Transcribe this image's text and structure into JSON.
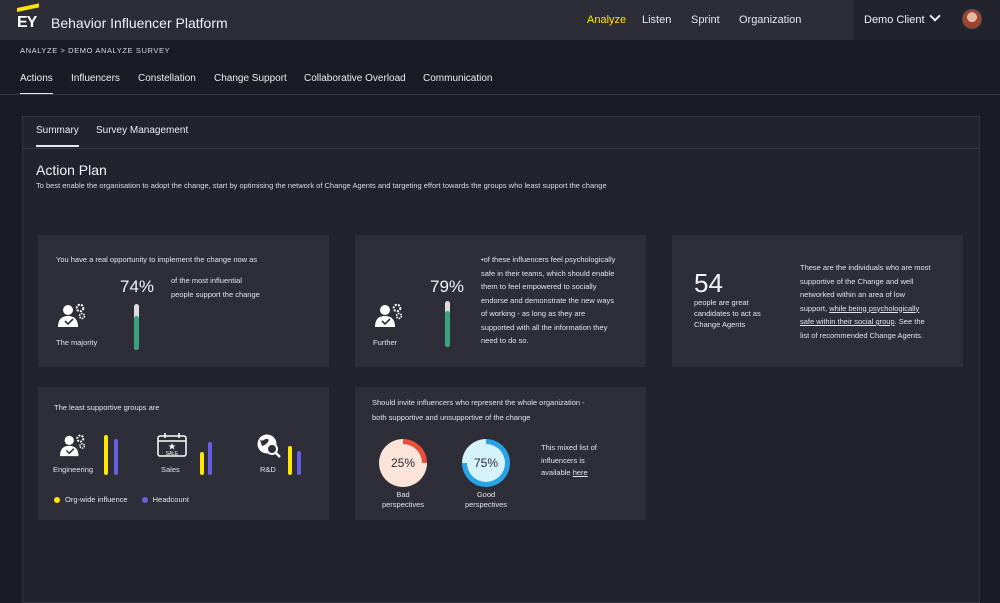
{
  "header": {
    "logo_text": "EY",
    "app_title": "Behavior Influencer Platform",
    "nav": [
      {
        "label": "Analyze",
        "active": true
      },
      {
        "label": "Listen",
        "active": false
      },
      {
        "label": "Sprint",
        "active": false
      },
      {
        "label": "Organization",
        "active": false
      }
    ],
    "client": "Demo Client",
    "icons": {
      "dropdown": "chevron-down-icon",
      "user": "avatar"
    }
  },
  "breadcrumb": "ANALYZE > DEMO ANALYZE SURVEY",
  "tabs": [
    "Actions",
    "Influencers",
    "Constellation",
    "Change Support",
    "Collaborative Overload",
    "Communication"
  ],
  "active_tab": "Actions",
  "subtabs": [
    "Summary",
    "Survey Management"
  ],
  "active_subtab": "Summary",
  "action_plan": {
    "title": "Action Plan",
    "subtitle": "To best enable the organisation to adopt the change, start by optimising the network of Change Agents and targeting effort towards the groups who least support the change"
  },
  "card1": {
    "heading": "You have a real opportunity to implement the change now as",
    "percent": "74%",
    "percent_value": 0.74,
    "text1": "of the most influential",
    "text2": "people support the change",
    "label": "The majority"
  },
  "card2": {
    "percent": "79%",
    "percent_value": 0.79,
    "label": "Further",
    "lines": [
      "•of these influencers feel psychologically",
      "safe in their teams, which should enable",
      "them to feel empowered to socially",
      "endorse and demonstrate the new ways",
      "of working - as long as they are",
      "supported with all the information they",
      "need to do so."
    ]
  },
  "card3": {
    "number": "54",
    "caption": [
      "people are great",
      "candidates to act as",
      "Change Agents"
    ],
    "lines": [
      "These are the individuals who are most",
      "supportive of the Change and well",
      "networked within an area of low"
    ],
    "line4a": "support, ",
    "line4b": "while being psychologically",
    "line5a": "safe within their social group",
    "line5b": ". See the",
    "line6": "list of recommended Change Agents."
  },
  "card4": {
    "heading": "The least supportive groups are",
    "groups": [
      {
        "name": "Engineering",
        "icon": "people-gear-icon",
        "influence": 0.95,
        "headcount": 0.85
      },
      {
        "name": "Sales",
        "icon": "sale-calendar-icon",
        "influence": 0.55,
        "headcount": 0.78
      },
      {
        "name": "R&D",
        "icon": "globe-search-icon",
        "influence": 0.68,
        "headcount": 0.58
      }
    ],
    "legend": [
      {
        "label": "Org-wide influence",
        "color": "#ffe600"
      },
      {
        "label": "Headcount",
        "color": "#6b5de0"
      }
    ]
  },
  "card5": {
    "heading1": "Should invite influencers who represent the whole organization -",
    "heading2": "both supportive and unsupportive of the change",
    "bad": {
      "value": "25%",
      "fraction": 0.25,
      "label1": "Bad",
      "label2": "perspectives",
      "color": "#e8503a",
      "fill": "#fde4d8"
    },
    "good": {
      "value": "75%",
      "fraction": 0.75,
      "label1": "Good",
      "label2": "perspectives",
      "color": "#29a3e6",
      "fill": "#d6f3fb"
    },
    "mixed": [
      "This mixed list of",
      "influencers is",
      "available "
    ],
    "mixed_link": "here"
  }
}
